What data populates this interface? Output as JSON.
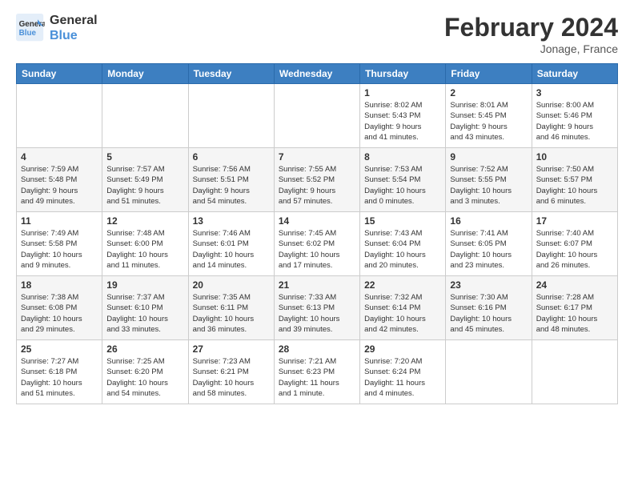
{
  "header": {
    "logo_line1": "General",
    "logo_line2": "Blue",
    "month_title": "February 2024",
    "location": "Jonage, France"
  },
  "days_of_week": [
    "Sunday",
    "Monday",
    "Tuesday",
    "Wednesday",
    "Thursday",
    "Friday",
    "Saturday"
  ],
  "weeks": [
    [
      {
        "day": "",
        "info": ""
      },
      {
        "day": "",
        "info": ""
      },
      {
        "day": "",
        "info": ""
      },
      {
        "day": "",
        "info": ""
      },
      {
        "day": "1",
        "info": "Sunrise: 8:02 AM\nSunset: 5:43 PM\nDaylight: 9 hours\nand 41 minutes."
      },
      {
        "day": "2",
        "info": "Sunrise: 8:01 AM\nSunset: 5:45 PM\nDaylight: 9 hours\nand 43 minutes."
      },
      {
        "day": "3",
        "info": "Sunrise: 8:00 AM\nSunset: 5:46 PM\nDaylight: 9 hours\nand 46 minutes."
      }
    ],
    [
      {
        "day": "4",
        "info": "Sunrise: 7:59 AM\nSunset: 5:48 PM\nDaylight: 9 hours\nand 49 minutes."
      },
      {
        "day": "5",
        "info": "Sunrise: 7:57 AM\nSunset: 5:49 PM\nDaylight: 9 hours\nand 51 minutes."
      },
      {
        "day": "6",
        "info": "Sunrise: 7:56 AM\nSunset: 5:51 PM\nDaylight: 9 hours\nand 54 minutes."
      },
      {
        "day": "7",
        "info": "Sunrise: 7:55 AM\nSunset: 5:52 PM\nDaylight: 9 hours\nand 57 minutes."
      },
      {
        "day": "8",
        "info": "Sunrise: 7:53 AM\nSunset: 5:54 PM\nDaylight: 10 hours\nand 0 minutes."
      },
      {
        "day": "9",
        "info": "Sunrise: 7:52 AM\nSunset: 5:55 PM\nDaylight: 10 hours\nand 3 minutes."
      },
      {
        "day": "10",
        "info": "Sunrise: 7:50 AM\nSunset: 5:57 PM\nDaylight: 10 hours\nand 6 minutes."
      }
    ],
    [
      {
        "day": "11",
        "info": "Sunrise: 7:49 AM\nSunset: 5:58 PM\nDaylight: 10 hours\nand 9 minutes."
      },
      {
        "day": "12",
        "info": "Sunrise: 7:48 AM\nSunset: 6:00 PM\nDaylight: 10 hours\nand 11 minutes."
      },
      {
        "day": "13",
        "info": "Sunrise: 7:46 AM\nSunset: 6:01 PM\nDaylight: 10 hours\nand 14 minutes."
      },
      {
        "day": "14",
        "info": "Sunrise: 7:45 AM\nSunset: 6:02 PM\nDaylight: 10 hours\nand 17 minutes."
      },
      {
        "day": "15",
        "info": "Sunrise: 7:43 AM\nSunset: 6:04 PM\nDaylight: 10 hours\nand 20 minutes."
      },
      {
        "day": "16",
        "info": "Sunrise: 7:41 AM\nSunset: 6:05 PM\nDaylight: 10 hours\nand 23 minutes."
      },
      {
        "day": "17",
        "info": "Sunrise: 7:40 AM\nSunset: 6:07 PM\nDaylight: 10 hours\nand 26 minutes."
      }
    ],
    [
      {
        "day": "18",
        "info": "Sunrise: 7:38 AM\nSunset: 6:08 PM\nDaylight: 10 hours\nand 29 minutes."
      },
      {
        "day": "19",
        "info": "Sunrise: 7:37 AM\nSunset: 6:10 PM\nDaylight: 10 hours\nand 33 minutes."
      },
      {
        "day": "20",
        "info": "Sunrise: 7:35 AM\nSunset: 6:11 PM\nDaylight: 10 hours\nand 36 minutes."
      },
      {
        "day": "21",
        "info": "Sunrise: 7:33 AM\nSunset: 6:13 PM\nDaylight: 10 hours\nand 39 minutes."
      },
      {
        "day": "22",
        "info": "Sunrise: 7:32 AM\nSunset: 6:14 PM\nDaylight: 10 hours\nand 42 minutes."
      },
      {
        "day": "23",
        "info": "Sunrise: 7:30 AM\nSunset: 6:16 PM\nDaylight: 10 hours\nand 45 minutes."
      },
      {
        "day": "24",
        "info": "Sunrise: 7:28 AM\nSunset: 6:17 PM\nDaylight: 10 hours\nand 48 minutes."
      }
    ],
    [
      {
        "day": "25",
        "info": "Sunrise: 7:27 AM\nSunset: 6:18 PM\nDaylight: 10 hours\nand 51 minutes."
      },
      {
        "day": "26",
        "info": "Sunrise: 7:25 AM\nSunset: 6:20 PM\nDaylight: 10 hours\nand 54 minutes."
      },
      {
        "day": "27",
        "info": "Sunrise: 7:23 AM\nSunset: 6:21 PM\nDaylight: 10 hours\nand 58 minutes."
      },
      {
        "day": "28",
        "info": "Sunrise: 7:21 AM\nSunset: 6:23 PM\nDaylight: 11 hours\nand 1 minute."
      },
      {
        "day": "29",
        "info": "Sunrise: 7:20 AM\nSunset: 6:24 PM\nDaylight: 11 hours\nand 4 minutes."
      },
      {
        "day": "",
        "info": ""
      },
      {
        "day": "",
        "info": ""
      }
    ]
  ]
}
